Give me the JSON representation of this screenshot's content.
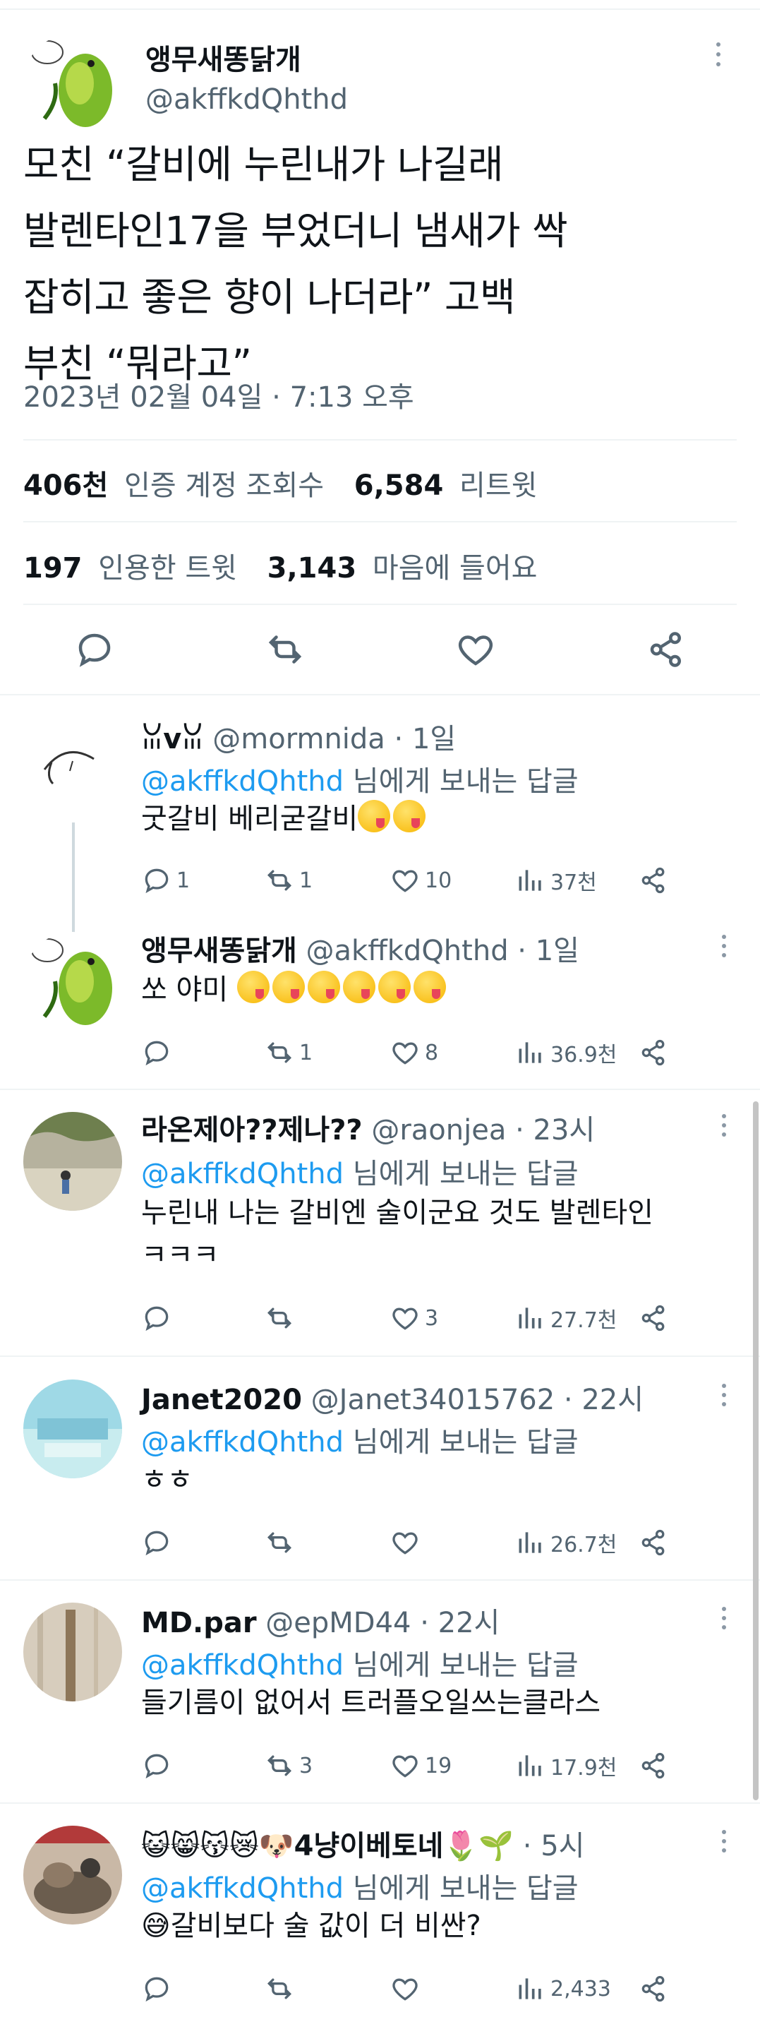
{
  "main_tweet": {
    "author_name": "앵무새똥닭개",
    "author_handle": "@akffkdQhthd",
    "body_lines": [
      "모친 “갈비에 누린내가 나길래",
      "발렌타인17을 부었더니 냄새가 싹",
      "잡히고 좋은 향이 나더라” 고백",
      "부친 “뭐라고”"
    ],
    "timestamp": "2023년 02월 04일 · 7:13 오후",
    "views_count": "406천",
    "views_label": "인증 계정 조회수",
    "retweets_count": "6,584",
    "retweets_label": "리트윗",
    "quotes_count": "197",
    "quotes_label": "인용한 트윗",
    "likes_count": "3,143",
    "likes_label": "마음에 들어요"
  },
  "replies": [
    {
      "name": "ꈍvꈍ",
      "handle": "@mormnida · 1일",
      "reply_to_at": "@akffkdQhthd",
      "reply_to_suffix": " 님에게 보내는 답글",
      "text": "굿갈비 베리굳갈비",
      "emoji_count": 2,
      "replies": "1",
      "retweets": "1",
      "likes": "10",
      "views": "37천"
    },
    {
      "name": "앵무새똥닭개",
      "handle": "@akffkdQhthd · 1일",
      "text": "쏘 야미",
      "emoji_count": 6,
      "replies": "",
      "retweets": "1",
      "likes": "8",
      "views": "36.9천"
    },
    {
      "name": "라온제아??제나??",
      "handle": "@raonjea · 23시",
      "reply_to_at": "@akffkdQhthd",
      "reply_to_suffix": " 님에게 보내는 답글",
      "text_lines": [
        "누린내 나는 갈비엔 술이군요 것도 발렌타인",
        "ㅋㅋㅋ"
      ],
      "replies": "",
      "retweets": "",
      "likes": "3",
      "views": "27.7천"
    },
    {
      "name": "Janet2020",
      "handle": "@Janet34015762 · 22시",
      "reply_to_at": "@akffkdQhthd",
      "reply_to_suffix": " 님에게 보내는 답글",
      "text": "ㅎㅎ",
      "replies": "",
      "retweets": "",
      "likes": "",
      "views": "26.7천"
    },
    {
      "name": "MD.par",
      "handle": "@epMD44 · 22시",
      "reply_to_at": "@akffkdQhthd",
      "reply_to_suffix": " 님에게 보내는 답글",
      "text": "들기름이 없어서 트러플오일쓰는클라스",
      "replies": "",
      "retweets": "3",
      "likes": "19",
      "views": "17.9천"
    },
    {
      "name": "😺😸😽😿🐶4냥이베토네🌷🌱",
      "handle": " · 5시",
      "reply_to_at": "@akffkdQhthd",
      "reply_to_suffix": " 님에게 보내는 답글",
      "text": "😅갈비보다 술 값이 더 비싼?",
      "replies": "",
      "retweets": "",
      "likes": "",
      "views": "2,433"
    }
  ],
  "icons": {
    "reply": "reply-icon",
    "retweet": "retweet-icon",
    "like": "heart-icon",
    "share": "share-icon",
    "views": "views-icon",
    "more": "more-icon"
  },
  "colors": {
    "link": "#1d9bf0",
    "secondary": "#536471",
    "text": "#0f1419"
  }
}
